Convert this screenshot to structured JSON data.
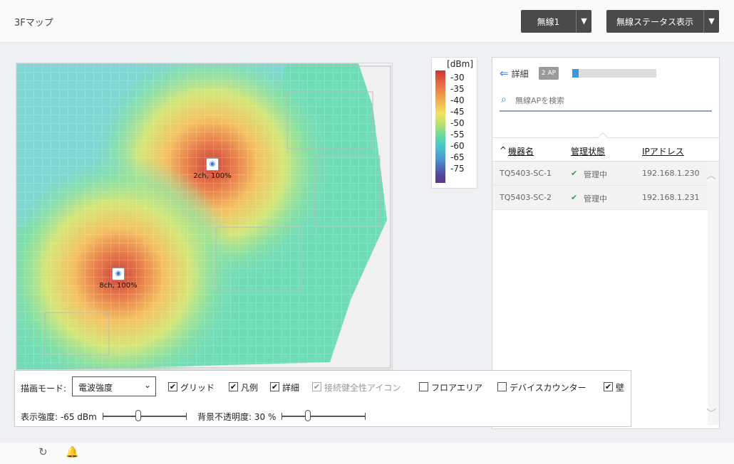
{
  "header": {
    "title": "3Fマップ",
    "radio_dropdown": {
      "label": "無線1",
      "caret": "▼"
    },
    "status_dropdown": {
      "label": "無線ステータス表示",
      "caret": "▼"
    }
  },
  "map": {
    "aps": [
      {
        "label": "2ch, 100%",
        "icon": "wifi-icon"
      },
      {
        "label": "8ch, 100%",
        "icon": "wifi-icon"
      }
    ]
  },
  "legend": {
    "unit": "[dBm]",
    "ticks": [
      "-30",
      "-35",
      "-40",
      "-45",
      "-50",
      "-55",
      "-60",
      "-65",
      "-75"
    ]
  },
  "panel": {
    "detail_label": "詳細",
    "ap_badge": "2 AP",
    "ap_progress": 0.08,
    "search_placeholder": "無線APを検索",
    "columns": {
      "name": "機器名",
      "status": "管理状態",
      "ip": "IPアドレス"
    },
    "sort_indicator": "^",
    "rows": [
      {
        "name": "TQ5403-SC-1",
        "status": "管理中",
        "ip": "192.168.1.230"
      },
      {
        "name": "TQ5403-SC-2",
        "status": "管理中",
        "ip": "192.168.1.231"
      }
    ]
  },
  "settings": {
    "mode_label": "描画モード:",
    "mode_value": "電波強度",
    "checkboxes": [
      {
        "label": "グリッド",
        "checked": true,
        "disabled": false
      },
      {
        "label": "凡例",
        "checked": true,
        "disabled": false
      },
      {
        "label": "詳細",
        "checked": true,
        "disabled": false
      },
      {
        "label": "接続健全性アイコン",
        "checked": true,
        "disabled": true
      },
      {
        "label": "フロアエリア",
        "checked": false,
        "disabled": false
      },
      {
        "label": "デバイスカウンター",
        "checked": false,
        "disabled": false
      },
      {
        "label": "壁",
        "checked": true,
        "disabled": false
      }
    ],
    "strength_label": "表示強度: -65 dBm",
    "strength_value_dbm": -65,
    "opacity_label": "背景不透明度: 30 %",
    "opacity_value_pct": 30
  },
  "colors": {
    "accent": "#3a7bd5",
    "dark_button": "#4a4a4a",
    "check_green": "#3aa04a"
  }
}
